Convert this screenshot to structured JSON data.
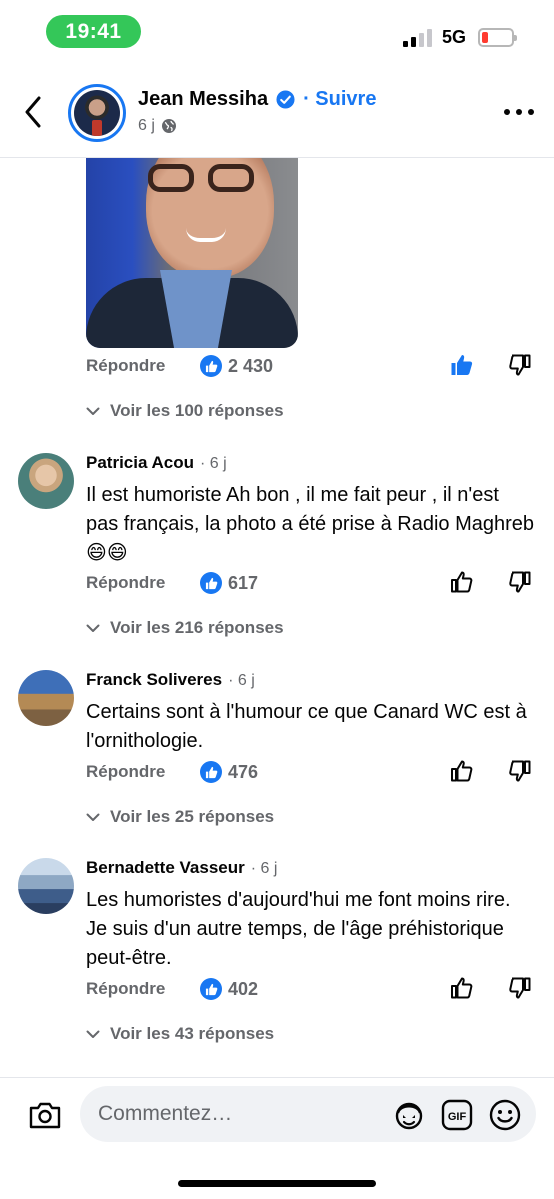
{
  "status_bar": {
    "time": "19:41",
    "network": "5G",
    "battery_level": 0.15,
    "battery_color": "#ff3b30",
    "time_pill_color": "#34c759"
  },
  "header": {
    "author_name": "Jean Messiha",
    "follow_label": "· Suivre",
    "post_age": "6 j",
    "icons": {
      "back": "chevron-left-icon",
      "verified": "verified-badge-icon",
      "audience": "globe-icon",
      "more": "more-horizontal-icon"
    }
  },
  "accent_color": "#1877f2",
  "first_comment": {
    "reply_label": "Répondre",
    "like_count": "2 430",
    "liked_by_user": true,
    "see_replies": "Voir les 100 réponses"
  },
  "comments": [
    {
      "author": "Patricia Acou",
      "time": "· 6 j",
      "text": "Il est humoriste Ah bon , il me fait peur , il n'est pas français, la photo a été prise à Radio Maghreb 😄😄",
      "reply_label": "Répondre",
      "like_count": "617",
      "see_replies": "Voir les 216 réponses"
    },
    {
      "author": "Franck Soliveres",
      "time": "· 6 j",
      "text": "Certains sont à l'humour ce que Canard WC est à l'ornithologie.",
      "reply_label": "Répondre",
      "like_count": "476",
      "see_replies": "Voir les 25 réponses"
    },
    {
      "author": "Bernadette Vasseur",
      "time": "· 6 j",
      "text": "Les humoristes d'aujourd'hui me font moins rire. Je suis d'un autre temps, de l'âge préhistorique peut-être.",
      "reply_label": "Répondre",
      "like_count": "402",
      "see_replies": "Voir les 43 réponses"
    }
  ],
  "composer": {
    "placeholder": "Commentez…",
    "icons": [
      "camera-icon",
      "avatar-sticker-icon",
      "gif-icon",
      "emoji-icon"
    ]
  }
}
